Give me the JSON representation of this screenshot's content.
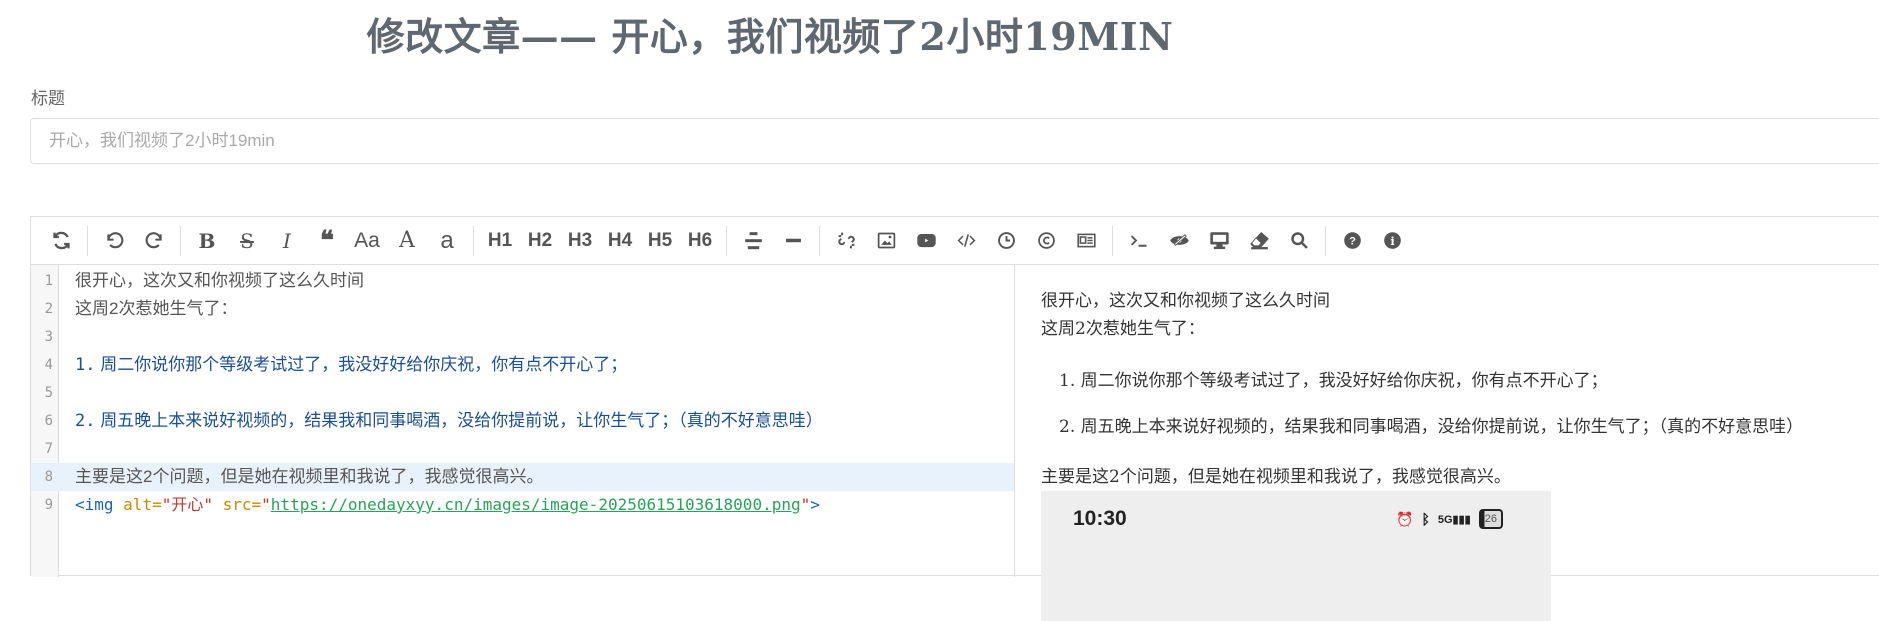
{
  "page": {
    "title": "修改文章—— 开心，我们视频了2小时19MIN"
  },
  "form": {
    "title_label": "标题",
    "title_placeholder": "开心，我们视频了2小时19min"
  },
  "toolbar": {
    "groups": [
      [
        "refresh-icon"
      ],
      [
        "undo-icon",
        "redo-icon"
      ],
      [
        "bold-icon",
        "strikethrough-icon",
        "italic-icon",
        "quote-icon",
        "uppercase-icon",
        "first-letter-uppercase-icon",
        "lowercase-icon"
      ],
      [
        "H1",
        "H2",
        "H3",
        "H4",
        "H5",
        "H6"
      ],
      [
        "list-icon",
        "hr-icon"
      ],
      [
        "link-icon",
        "image-icon",
        "video-icon",
        "code-icon",
        "datetime-icon",
        "copyright-icon",
        "code-block-icon"
      ],
      [
        "terminal-icon",
        "preview-toggle-icon",
        "fullscreen-icon",
        "clear-icon",
        "search-icon"
      ],
      [
        "help-icon",
        "info-icon"
      ]
    ],
    "headings": [
      "H1",
      "H2",
      "H3",
      "H4",
      "H5",
      "H6"
    ],
    "case_labels": [
      "Aa",
      "A",
      "a"
    ]
  },
  "editor": {
    "lines": [
      {
        "n": "1",
        "text": "很开心，这次又和你视频了这么久时间"
      },
      {
        "n": "2",
        "text": "这周2次惹她生气了："
      },
      {
        "n": "3",
        "text": ""
      },
      {
        "n": "4",
        "num": "1.",
        "text": " 周二你说你那个等级考试过了，我没好好给你庆祝，你有点不开心了；"
      },
      {
        "n": "5",
        "text": ""
      },
      {
        "n": "6",
        "num": "2.",
        "text": " 周五晚上本来说好视频的，结果我和同事喝酒，没给你提前说，让你生气了；（真的不好意思哇）"
      },
      {
        "n": "7",
        "text": ""
      },
      {
        "n": "8",
        "text": "主要是这2个问题，但是她在视频里和我说了，我感觉很高兴。"
      },
      {
        "n": "9",
        "tag_open": "<img ",
        "attr_alt": "alt=",
        "alt_val": "\"开心\"",
        "attr_src": " src=",
        "quote1": "\"",
        "url": "https://onedayxyy.cn/images/image-20250615103618000.png",
        "quote2": "\"",
        "tag_close": ">"
      }
    ]
  },
  "preview": {
    "p1": "很开心，这次又和你视频了这么久时间",
    "p2": "这周2次惹她生气了：",
    "li1": "1. 周二你说你那个等级考试过了，我没好好给你庆祝，你有点不开心了；",
    "li2": "2. 周五晚上本来说好视频的，结果我和同事喝酒，没给你提前说，让你生气了；（真的不好意思哇）",
    "p3": "主要是这2个问题，但是她在视频里和我说了，我感觉很高兴。",
    "image": {
      "time": "10:30",
      "signal": "5G",
      "battery": "26"
    }
  },
  "colors": {
    "title": "#5f6770",
    "list_text": "#1b4f93",
    "active_line": "#e8f2fc",
    "url": "#27a35a"
  }
}
